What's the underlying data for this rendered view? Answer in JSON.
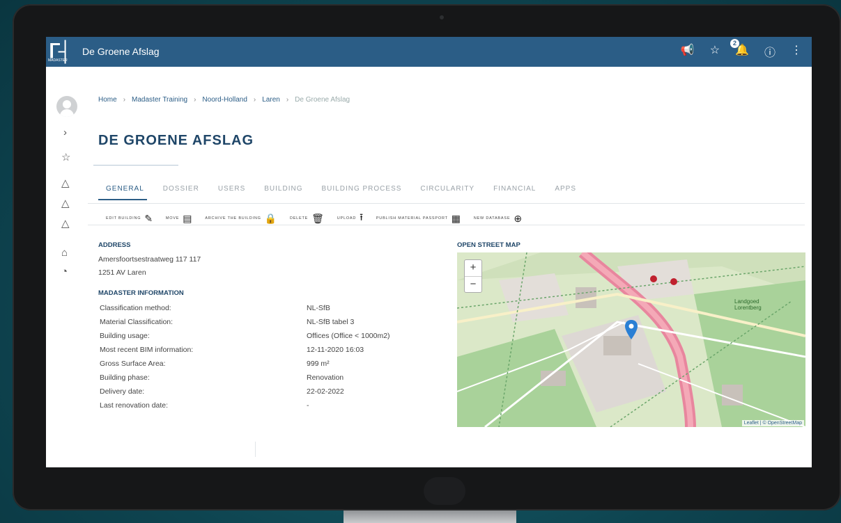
{
  "app": {
    "logo_text": "MADASTER",
    "title": "De Groene Afslag",
    "notification_count": "2"
  },
  "breadcrumb": [
    "Home",
    "Madaster Training",
    "Noord-Holland",
    "Laren",
    "De Groene Afslag"
  ],
  "page_title": "DE GROENE AFSLAG",
  "tabs": [
    "GENERAL",
    "DOSSIER",
    "USERS",
    "BUILDING",
    "BUILDING PROCESS",
    "CIRCULARITY",
    "FINANCIAL",
    "APPS"
  ],
  "active_tab": "GENERAL",
  "toolbar": [
    {
      "label": "EDIT BUILDING",
      "icon": "pencil-icon"
    },
    {
      "label": "MOVE",
      "icon": "move-building-icon"
    },
    {
      "label": "ARCHIVE THE BUILDING",
      "icon": "lock-icon"
    },
    {
      "label": "DELETE",
      "icon": "trash-icon"
    },
    {
      "label": "UPLOAD",
      "icon": "upload-icon"
    },
    {
      "label": "PUBLISH MATERIAL PASSPORT",
      "icon": "passport-icon"
    },
    {
      "label": "NEW DATABASE",
      "icon": "plus-circle-icon"
    }
  ],
  "address": {
    "heading": "ADDRESS",
    "line1": "Amersfoortsestraatweg 117 117",
    "line2": "1251 AV Laren"
  },
  "madaster_info": {
    "heading": "MADASTER INFORMATION",
    "rows": [
      {
        "label": "Classification method:",
        "value": "NL-SfB"
      },
      {
        "label": "Material Classification:",
        "value": "NL-SfB tabel 3"
      },
      {
        "label": "Building usage:",
        "value": "Offices (Office < 1000m2)"
      },
      {
        "label": "Most recent BIM information:",
        "value": "12-11-2020 16:03"
      },
      {
        "label": "Gross Surface Area:",
        "value": "999 m²"
      },
      {
        "label": "Building phase:",
        "value": "Renovation"
      },
      {
        "label": "Delivery date:",
        "value": "22-02-2022"
      },
      {
        "label": "Last renovation date:",
        "value": "-"
      }
    ]
  },
  "map": {
    "heading": "OPEN STREET MAP",
    "zoom_in": "+",
    "zoom_out": "−",
    "attribution": "Leaflet | © OpenStreetMap",
    "labels": [
      "Landgoed Lorentberg"
    ]
  },
  "colors": {
    "topbar": "#2b5d86",
    "heading": "#1f4668",
    "bezel": "#161718",
    "background": "#0f4752"
  }
}
